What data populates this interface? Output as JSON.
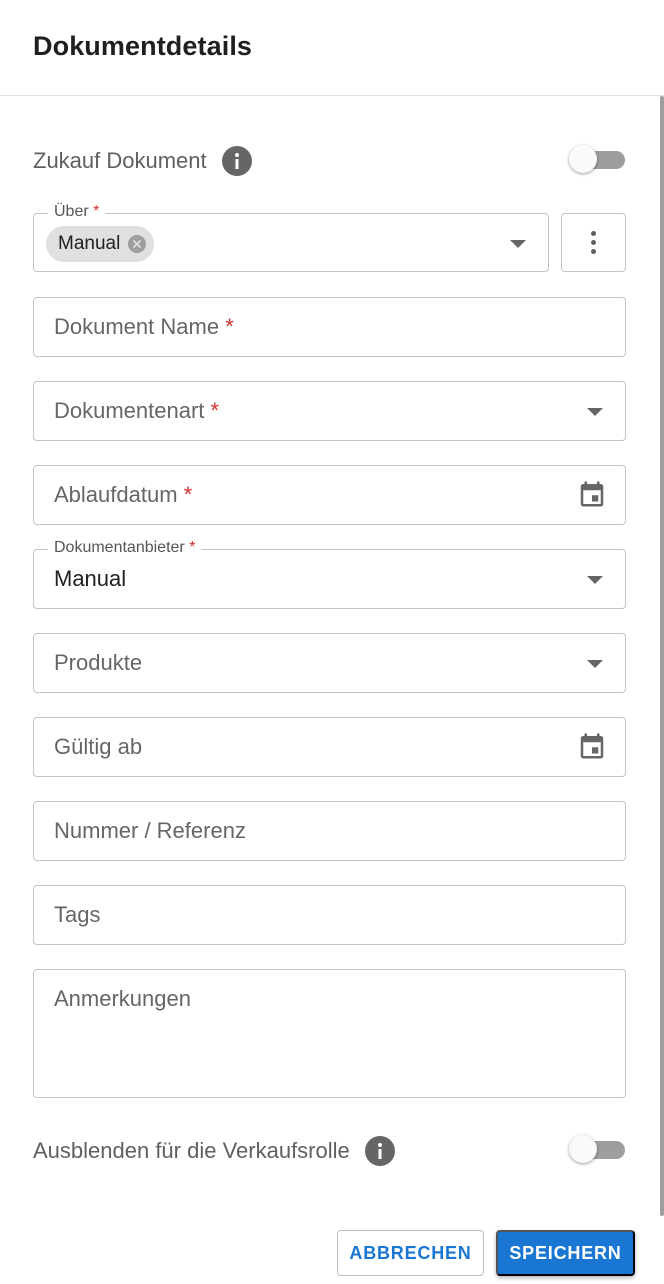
{
  "header": {
    "title": "Dokumentdetails"
  },
  "purchase_toggle": {
    "label": "Zukauf Dokument",
    "checked": false
  },
  "via": {
    "label": "Über",
    "required_mark": "*",
    "chip": "Manual"
  },
  "document_name": {
    "placeholder": "Dokument Name",
    "required_mark": "*"
  },
  "document_type": {
    "placeholder": "Dokumentenart",
    "required_mark": "*"
  },
  "expiry_date": {
    "placeholder": "Ablaufdatum",
    "required_mark": "*"
  },
  "document_provider": {
    "label": "Dokumentanbieter",
    "required_mark": "*",
    "value": "Manual"
  },
  "products": {
    "placeholder": "Produkte"
  },
  "valid_from": {
    "placeholder": "Gültig ab"
  },
  "reference": {
    "placeholder": "Nummer / Referenz"
  },
  "tags": {
    "placeholder": "Tags"
  },
  "notes": {
    "placeholder": "Anmerkungen"
  },
  "hide_toggle": {
    "label": "Ausblenden für die Verkaufsrolle",
    "checked": false
  },
  "actions": {
    "cancel": "ABBRECHEN",
    "save": "SPEICHERN"
  },
  "colors": {
    "primary": "#1976d2",
    "required": "#d32f2f",
    "border": "#c4c4c4"
  }
}
